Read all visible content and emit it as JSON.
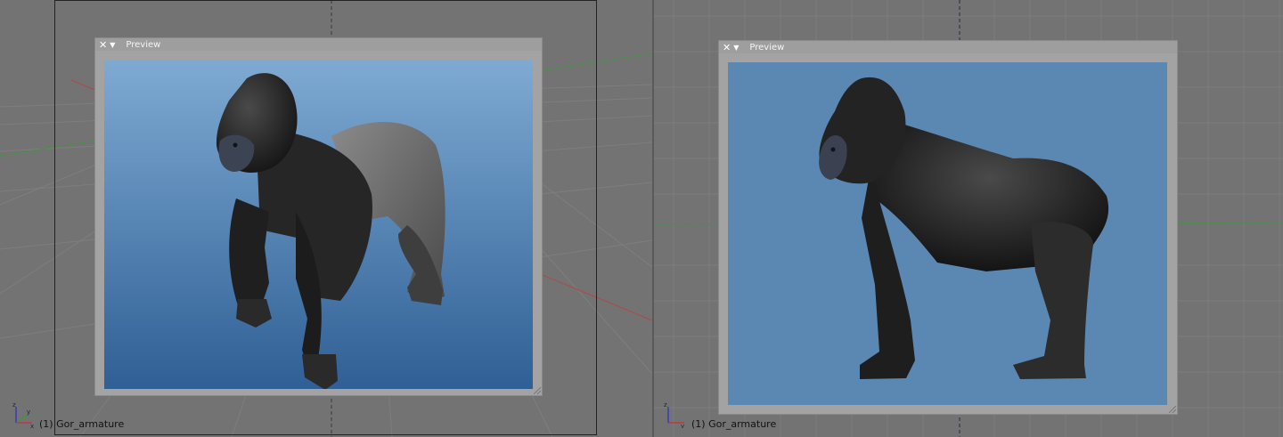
{
  "viewports": {
    "left": {
      "preview_title": "Preview",
      "object_label": "(1) Gor_armature",
      "axis": {
        "x": "x",
        "y": "y",
        "z": "z"
      }
    },
    "right": {
      "preview_title": "Preview",
      "object_label": "(1) Gor_armature",
      "axis": {
        "x": "x",
        "y": "y",
        "z": "z"
      }
    }
  },
  "colors": {
    "viewport_bg": "#737373",
    "grid_line": "#7d7d7d",
    "x_axis": "#b24a4a",
    "y_axis": "#4a9a4a",
    "preview_bg_left_top": "#7eaad2",
    "preview_bg_left_bottom": "#2f5f95",
    "preview_bg_right": "#5b88b3",
    "gorilla_dark": "#2a2a2a",
    "gorilla_grey": "#6a6a6a"
  },
  "icons": {
    "close": "close-icon",
    "menu": "dropdown-triangle-icon",
    "axis": "axis-gizmo-icon",
    "grip": "resize-grip-icon"
  }
}
